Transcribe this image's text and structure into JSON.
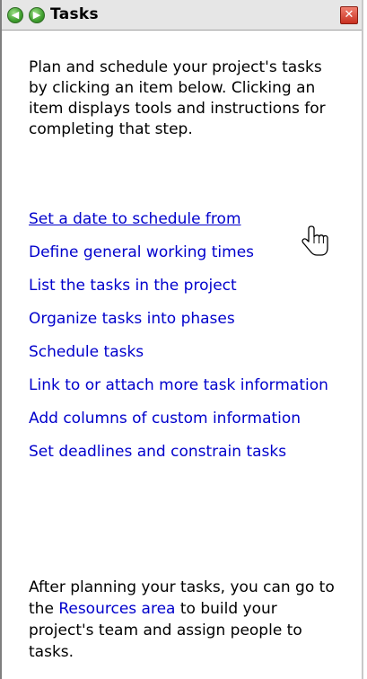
{
  "pane": {
    "title": "Tasks",
    "close_glyph": "✕",
    "back_glyph": "◀",
    "forward_glyph": "▶"
  },
  "intro": "Plan and schedule your project's tasks by clicking an item below. Clicking an item displays tools and instructions for completing that step.",
  "links": [
    "Set a date to schedule from",
    "Define general working times",
    "List the tasks in the project",
    "Organize tasks into phases",
    "Schedule tasks",
    "Link to or attach more task information",
    "Add columns of custom information",
    "Set deadlines and constrain tasks"
  ],
  "outro": {
    "before": "After planning your tasks, you can go to the ",
    "link": "Resources area",
    "after": " to build your project's team and assign people to tasks."
  },
  "colors": {
    "link": "#0000cc",
    "titlebar": "#e6e6e6",
    "close": "#c83020"
  }
}
